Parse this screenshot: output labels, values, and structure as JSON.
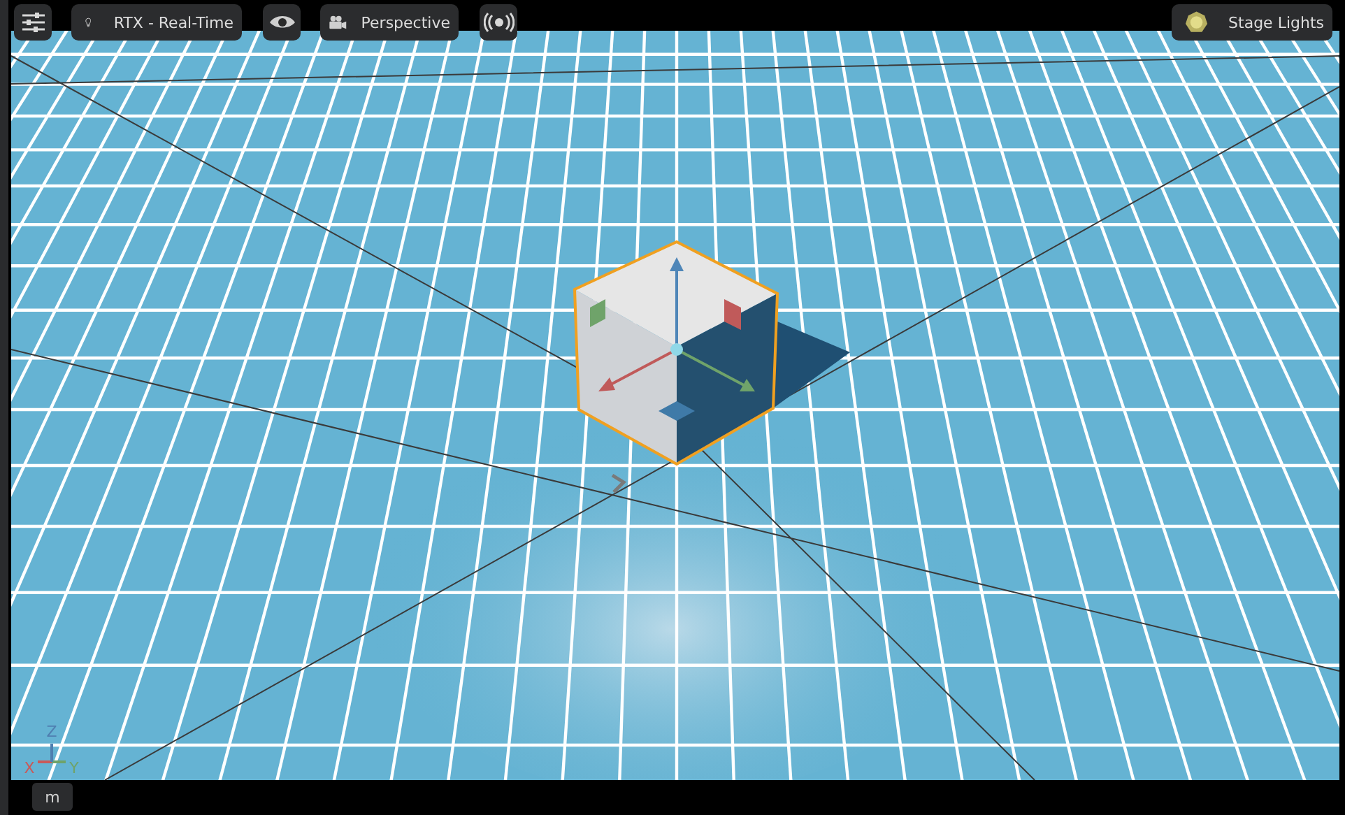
{
  "toolbar": {
    "render_mode": {
      "label": "RTX - Real-Time"
    },
    "camera": {
      "label": "Perspective"
    },
    "lights": {
      "label": "Stage Lights"
    }
  },
  "axis_indicator": [
    {
      "label": "X",
      "color": "#c85a5a"
    },
    {
      "label": "Y",
      "color": "#6fa36a"
    },
    {
      "label": "Z",
      "color": "#4f7fb0"
    }
  ],
  "bottom_bar": {
    "button": "m"
  }
}
